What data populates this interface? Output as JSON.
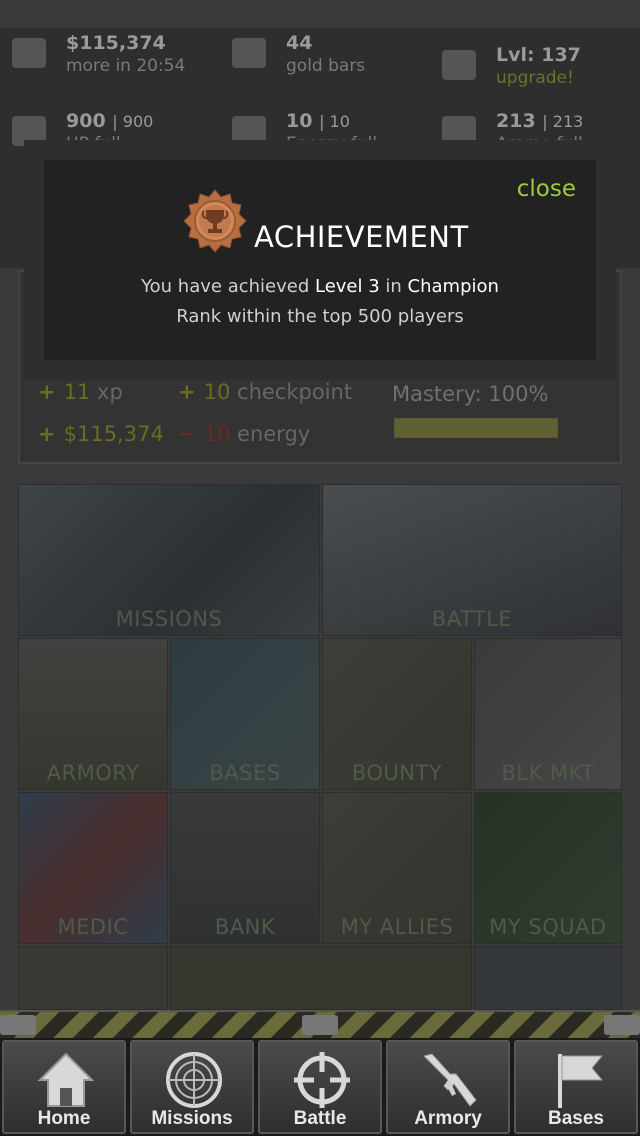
{
  "stats": {
    "money": {
      "value": "$115,374",
      "sub": "more in 20:54"
    },
    "gold": {
      "value": "44",
      "sub": "gold bars"
    },
    "level": {
      "value": "Lvl: 137",
      "sub": "upgrade!"
    },
    "hp": {
      "value": "900",
      "max": "| 900",
      "sub": "HP full"
    },
    "energy": {
      "value": "10",
      "max": "| 10",
      "sub": "Energy full"
    },
    "ammo": {
      "value": "213",
      "max": "| 213",
      "sub": "Ammo full"
    }
  },
  "mission": {
    "xp": {
      "amount": "11",
      "unit": "xp"
    },
    "checkpoint": {
      "amount": "10",
      "unit": "checkpoint"
    },
    "money": {
      "amount": "$115,374"
    },
    "energy": {
      "amount": "10",
      "unit": "energy"
    },
    "mastery_label": "Mastery: 100%",
    "mastery_fraction": 1.0
  },
  "tiles": {
    "missions": "MISSIONS",
    "battle": "BATTLE",
    "armory": "ARMORY",
    "bases": "BASES",
    "bounty": "BOUNTY",
    "blkmkt": "BLK MKT",
    "medic": "MEDIC",
    "bank": "BANK",
    "allies": "MY ALLIES",
    "squad": "MY SQUAD"
  },
  "modal": {
    "close_label": "close",
    "title": "ACHIEVEMENT",
    "line1_pre": "You have achieved ",
    "line1_level": "Level 3",
    "line1_mid": " in ",
    "line1_cat": "Champion",
    "line2": "Rank within the top 500 players",
    "medal_icon": "trophy-medal-icon",
    "colors": {
      "close": "#9ccc3c",
      "medal": "#c07a4a"
    }
  },
  "tabbar": {
    "home": {
      "label": "Home",
      "icon": "house-icon"
    },
    "missions": {
      "label": "Missions",
      "icon": "radar-icon"
    },
    "battle": {
      "label": "Battle",
      "icon": "crosshair-icon"
    },
    "armory": {
      "label": "Armory",
      "icon": "rifle-icon"
    },
    "bases": {
      "label": "Bases",
      "icon": "flag-icon"
    }
  }
}
